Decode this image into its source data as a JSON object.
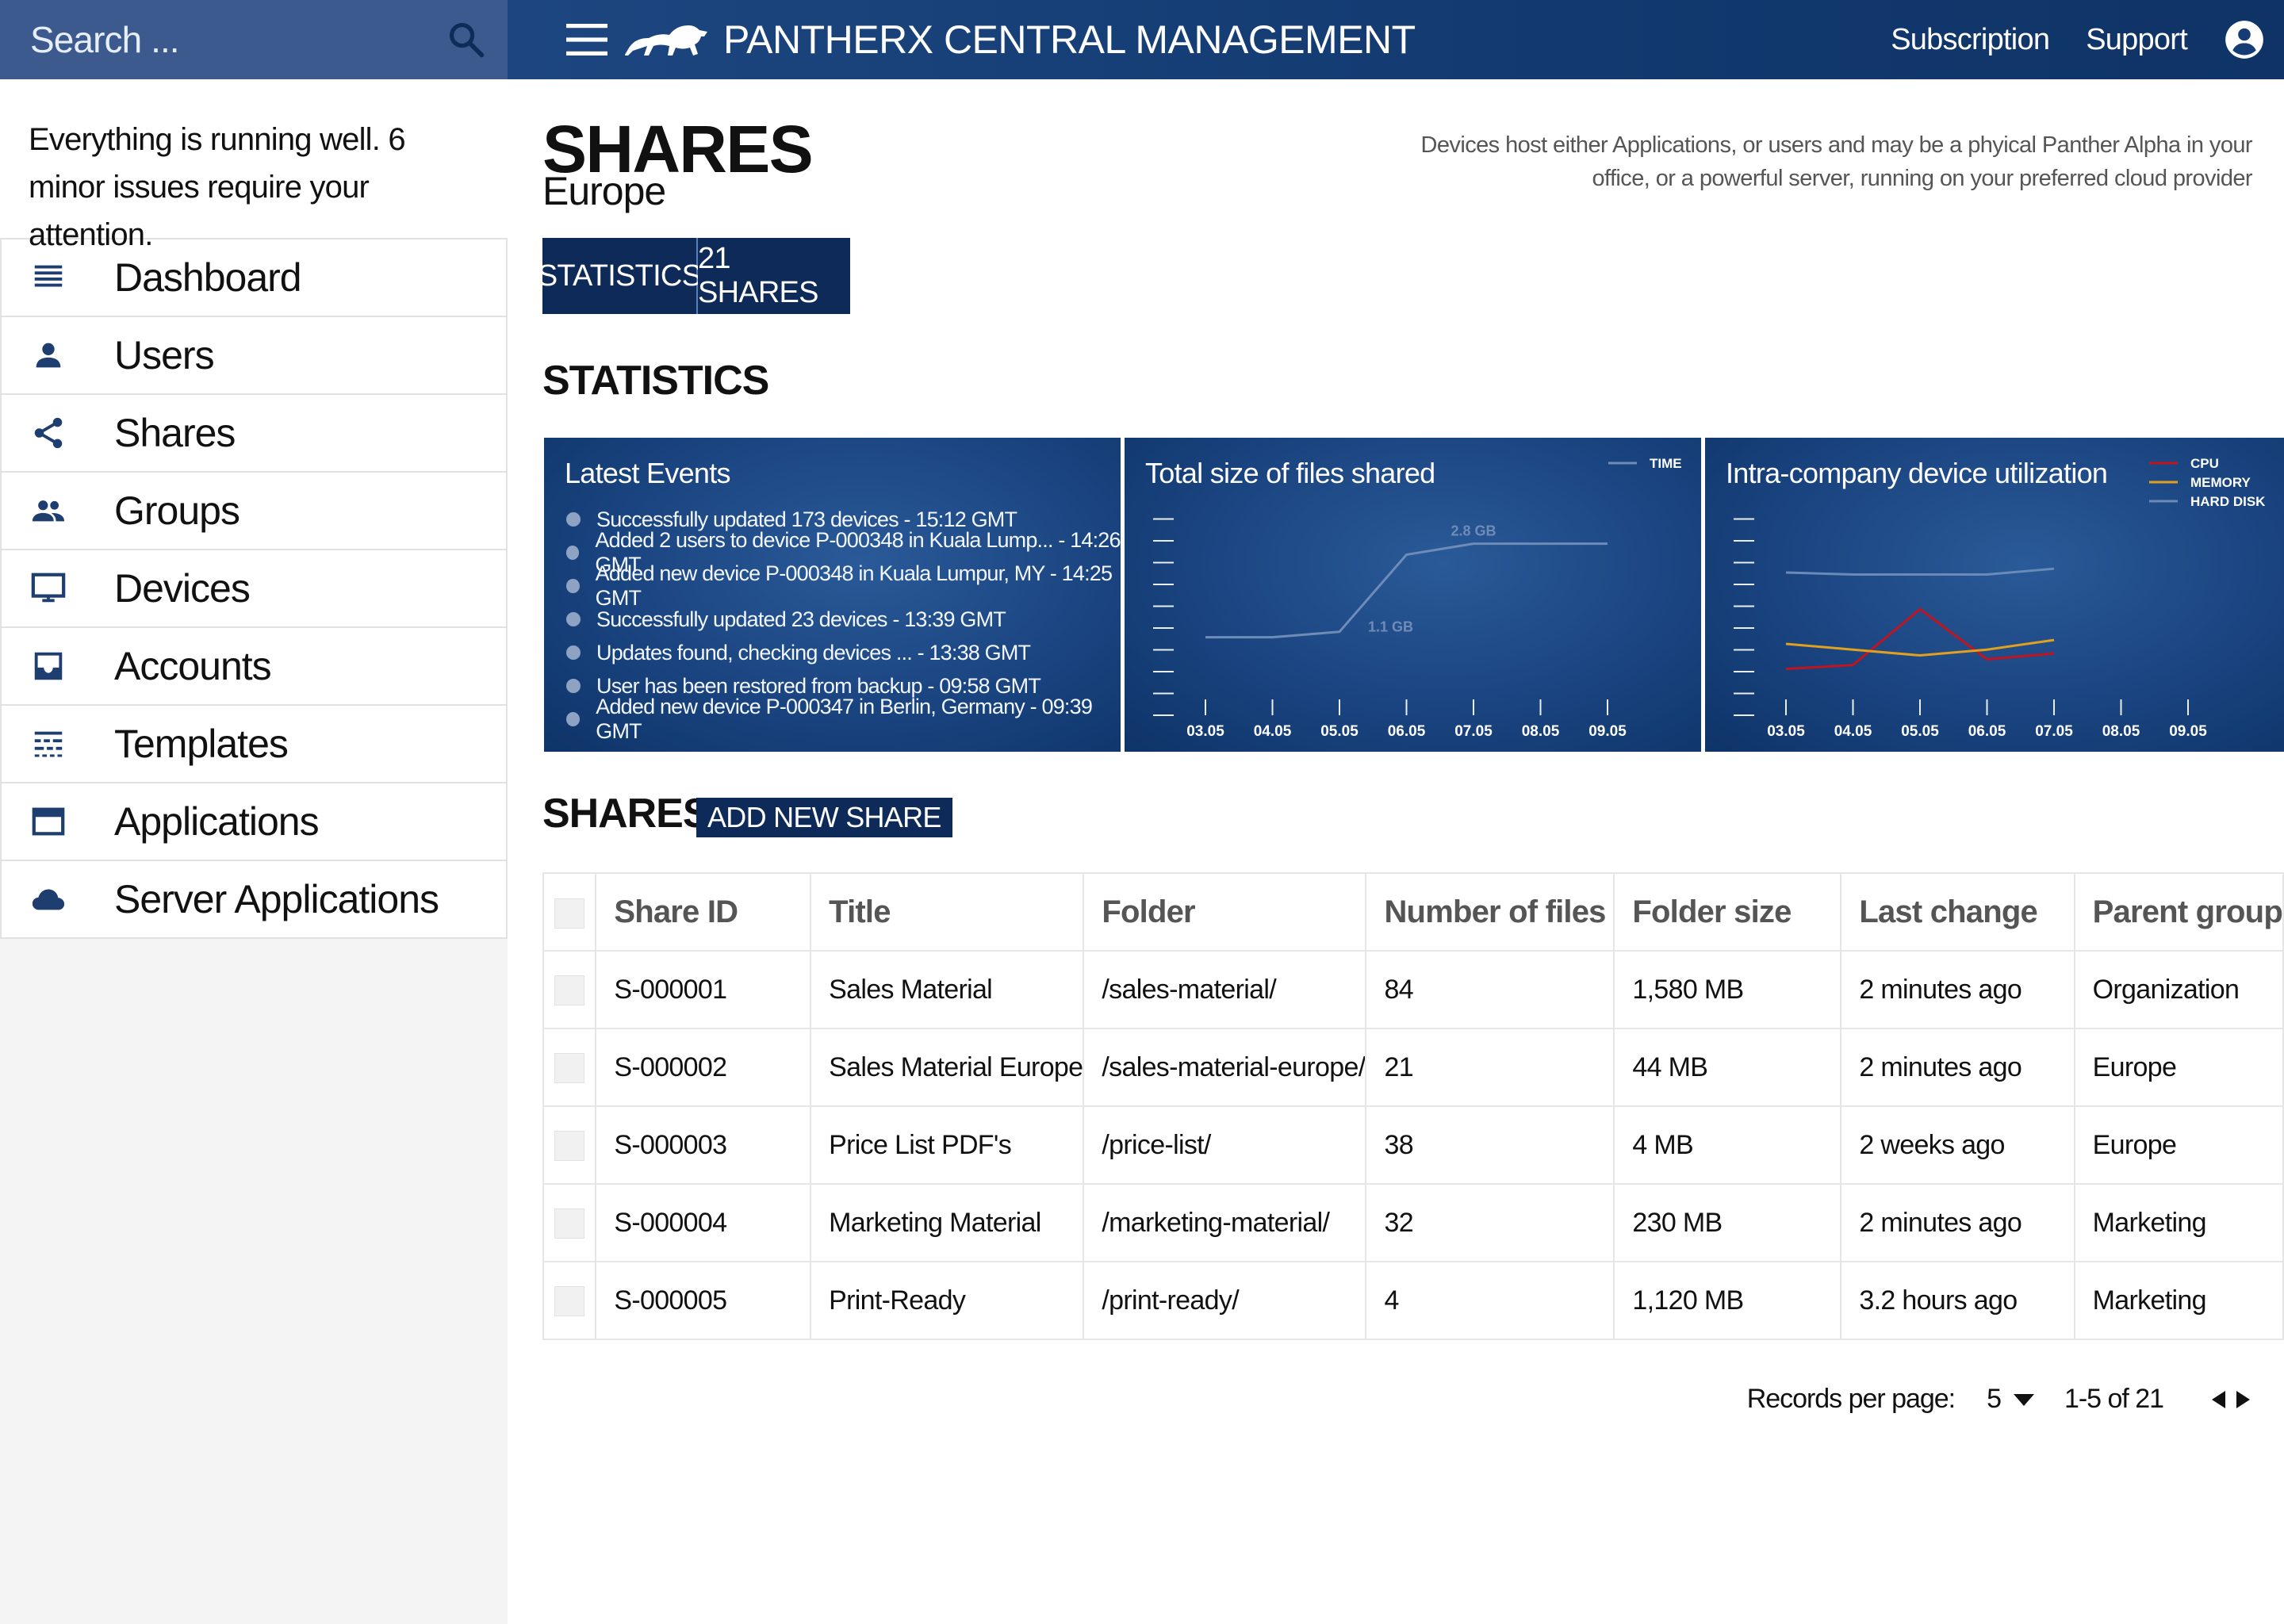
{
  "search": {
    "placeholder": "Search ..."
  },
  "header": {
    "title": "PANTHERX CENTRAL MANAGEMENT",
    "links": {
      "subscription": "Subscription",
      "support": "Support"
    }
  },
  "sidebar": {
    "status": "Everything is running well. 6 minor issues require your attention.",
    "items": [
      {
        "label": "Dashboard",
        "icon": "dashboard-icon"
      },
      {
        "label": "Users",
        "icon": "user-icon"
      },
      {
        "label": "Shares",
        "icon": "share-icon"
      },
      {
        "label": "Groups",
        "icon": "groups-icon"
      },
      {
        "label": "Devices",
        "icon": "monitor-icon"
      },
      {
        "label": "Accounts",
        "icon": "inbox-icon"
      },
      {
        "label": "Templates",
        "icon": "template-icon"
      },
      {
        "label": "Applications",
        "icon": "window-icon"
      },
      {
        "label": "Server Applications",
        "icon": "cloud-icon"
      }
    ]
  },
  "page": {
    "title": "SHARES",
    "subtitle": "Europe",
    "description": "Devices host either Applications, or users and may be a phyical Panther Alpha in your office, or a powerful server, running on your preferred cloud provider",
    "tabs": {
      "statistics": "STATISTICS",
      "shares": "21 SHARES"
    },
    "stats_heading": "STATISTICS",
    "shares_heading": "SHARES",
    "add_button": "ADD NEW SHARE"
  },
  "events": {
    "title": "Latest Events",
    "items": [
      "Successfully updated 173 devices - 15:12 GMT",
      "Added 2 users to device P-000348 in Kuala Lump... - 14:26 GMT",
      "Added new device P-000348 in Kuala Lumpur, MY - 14:25 GMT",
      "Successfully updated 23 devices - 13:39 GMT",
      "Updates found, checking devices ... - 13:38 GMT",
      "User has been restored from backup - 09:58 GMT",
      "Added new device P-000347 in Berlin, Germany - 09:39 GMT"
    ]
  },
  "colors": {
    "accent": "#0d2a58",
    "header": "#16407a",
    "search": "#3c5a8e",
    "cpu": "#c0141e",
    "memory": "#e0a020",
    "hard_disk": "#6a8ab8",
    "time": "#6f8bb8"
  },
  "chart_data": [
    {
      "type": "line",
      "title": "Total size of files shared",
      "categories": [
        "03.05",
        "04.05",
        "05.05",
        "06.05",
        "07.05",
        "08.05",
        "09.05"
      ],
      "series": [
        {
          "name": "TIME",
          "values": [
            1.1,
            1.1,
            1.2,
            2.6,
            2.8,
            2.8,
            2.8
          ]
        }
      ],
      "annotations": [
        "1.1 GB",
        "2.8 GB"
      ],
      "ylim": [
        0,
        3.5
      ],
      "legend": "top-right"
    },
    {
      "type": "line",
      "title": "Intra-company device utilization",
      "categories": [
        "03.05",
        "04.05",
        "05.05",
        "06.05",
        "07.05",
        "08.05",
        "09.05"
      ],
      "series": [
        {
          "name": "CPU",
          "values": [
            15,
            17,
            46,
            20,
            23
          ]
        },
        {
          "name": "MEMORY",
          "values": [
            28,
            25,
            22,
            25,
            30
          ]
        },
        {
          "name": "HARD DISK",
          "values": [
            65,
            64,
            64,
            64,
            67
          ]
        }
      ],
      "ylim": [
        0,
        100
      ],
      "legend": "top-right"
    }
  ],
  "table": {
    "columns": [
      "Share ID",
      "Title",
      "Folder",
      "Number of files",
      "Folder size",
      "Last change",
      "Parent group"
    ],
    "rows": [
      [
        "S-000001",
        "Sales Material",
        "/sales-material/",
        "84",
        "1,580 MB",
        "2 minutes ago",
        "Organization"
      ],
      [
        "S-000002",
        "Sales Material Europe",
        "/sales-material-europe/",
        "21",
        "44 MB",
        "2 minutes ago",
        "Europe"
      ],
      [
        "S-000003",
        "Price List PDF's",
        "/price-list/",
        "38",
        "4 MB",
        "2 weeks ago",
        "Europe"
      ],
      [
        "S-000004",
        "Marketing Material",
        "/marketing-material/",
        "32",
        "230 MB",
        "2 minutes ago",
        "Marketing"
      ],
      [
        "S-000005",
        "Print-Ready",
        "/print-ready/",
        "4",
        "1,120 MB",
        "3.2 hours ago",
        "Marketing"
      ]
    ]
  },
  "pagination": {
    "label": "Records per page:",
    "per_page": "5",
    "range": "1-5 of 21"
  }
}
